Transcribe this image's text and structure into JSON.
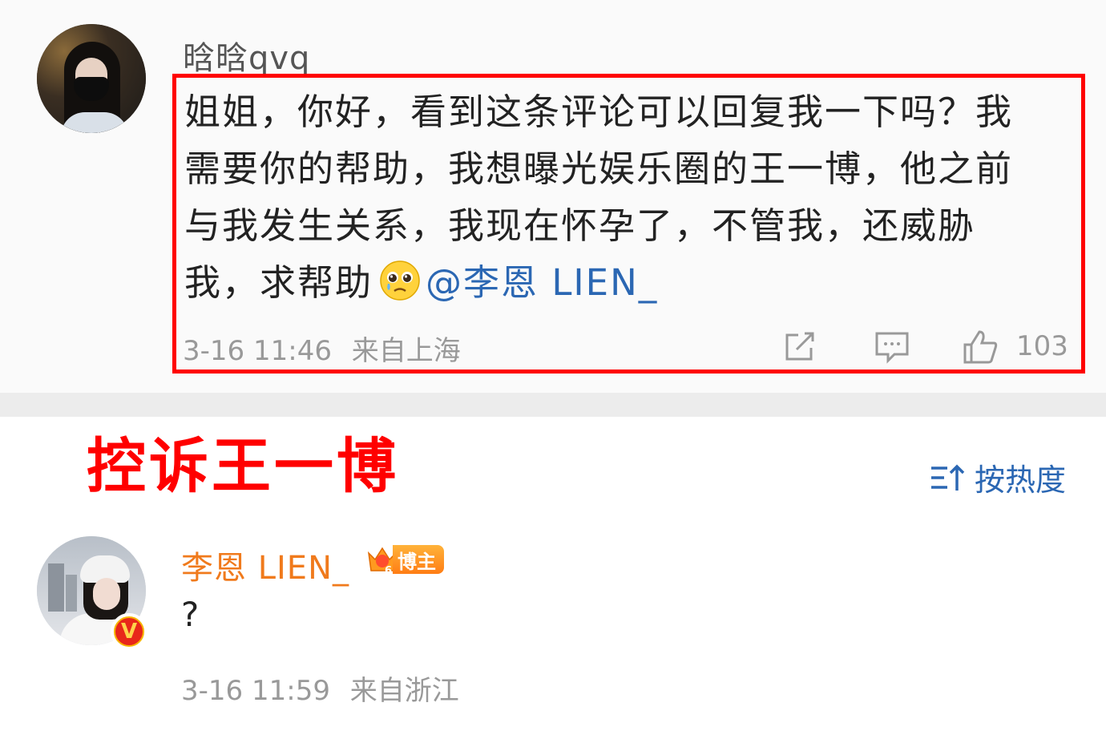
{
  "comment1": {
    "username": "晗晗qvq",
    "text_lines": [
      "姐姐，你好，看到这条评论可以回复我一下吗？我",
      "需要你的帮助，我想曝光娱乐圈的王一博，他之前",
      "与我发生关系，我现在怀孕了，不管我，还威胁",
      "我，求帮助"
    ],
    "mention": "@李恩 LIEN_",
    "timestamp": "3-16 11:46",
    "location": "来自上海",
    "like_count": "103",
    "icons": [
      "share-icon",
      "comment-icon",
      "like-icon"
    ],
    "emoji": "pleading-face-emoji"
  },
  "headline": "控诉王一博",
  "sort": {
    "label": "按热度",
    "icon": "sort-icon"
  },
  "comment2": {
    "username": "李恩 LIEN_",
    "badge_number": "6",
    "badge_label": "博主",
    "verified_mark": "V",
    "text": "?",
    "timestamp": "3-16 11:59",
    "location": "来自浙江"
  },
  "colors": {
    "highlight_border": "#ff0000",
    "headline": "#ff0000",
    "link": "#2b67b3",
    "blogger_name": "#f07a1c",
    "meta": "#999999"
  }
}
